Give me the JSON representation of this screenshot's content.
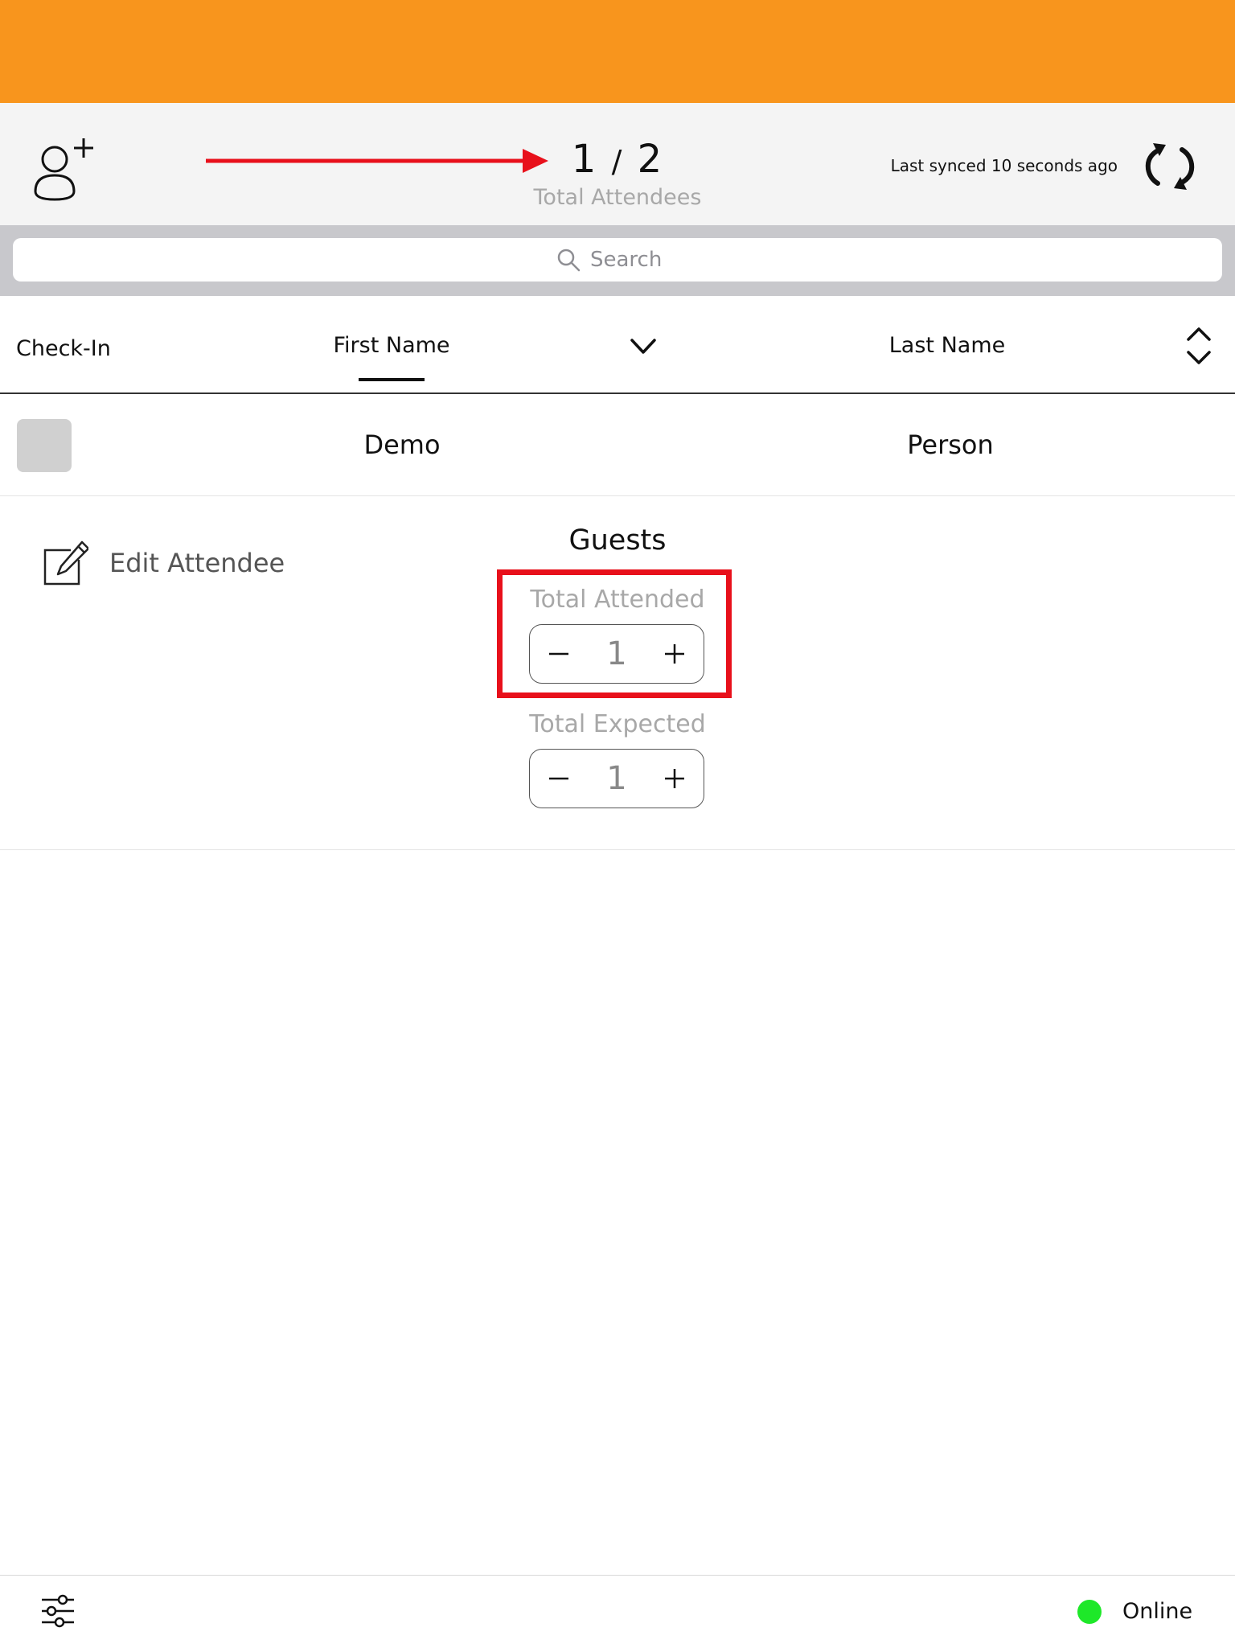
{
  "header": {
    "attended_count": "1",
    "separator": "/",
    "total_count": "2",
    "total_label": "Total Attendees",
    "sync_status": "Last synced 10 seconds ago"
  },
  "search": {
    "placeholder": "Search"
  },
  "table": {
    "columns": {
      "checkin": "Check-In",
      "first_name": "First Name",
      "last_name": "Last Name"
    },
    "rows": [
      {
        "first_name": "Demo",
        "last_name": "Person",
        "checked_in": false
      }
    ]
  },
  "detail": {
    "edit_label": "Edit Attendee",
    "guests_title": "Guests",
    "total_attended_label": "Total Attended",
    "total_attended_value": "1",
    "total_expected_label": "Total Expected",
    "total_expected_value": "1"
  },
  "footer": {
    "status": "Online"
  },
  "colors": {
    "brand_orange": "#F8951D",
    "annotation_red": "#E8101B",
    "online_green": "#1EE829"
  },
  "icons": {
    "add_attendee": "add-person-icon",
    "sync": "sync-icon",
    "search": "search-icon",
    "sort_first_name": "chevron-down-icon",
    "sort_last_name": "sort-icon",
    "edit": "edit-icon",
    "filter": "filter-icon"
  }
}
